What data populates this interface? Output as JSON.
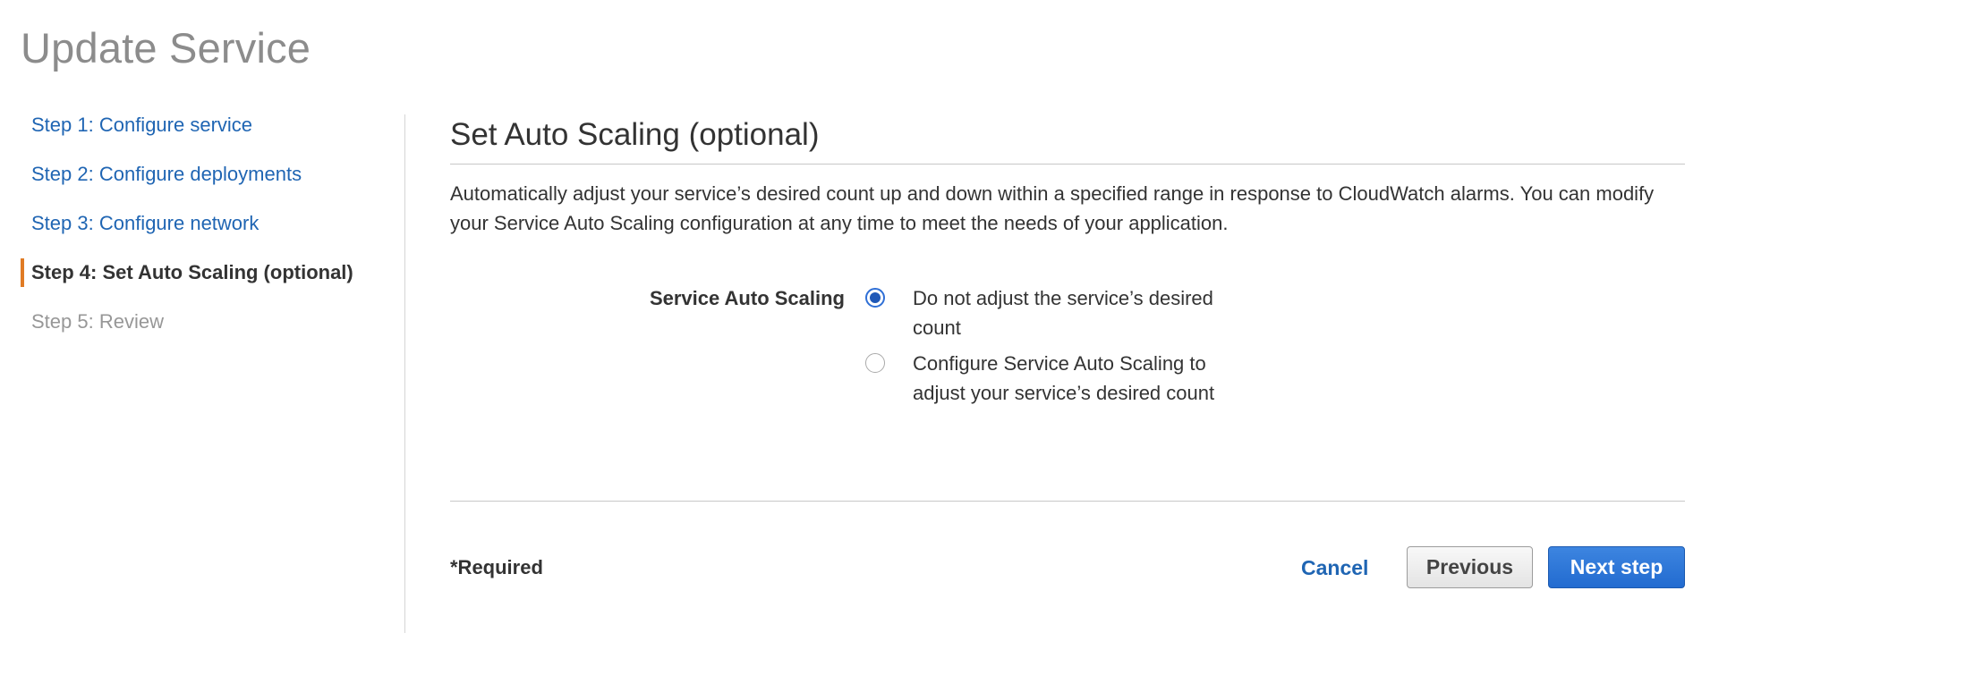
{
  "page": {
    "title": "Update Service"
  },
  "sidebar": {
    "steps": [
      {
        "label": "Step 1: Configure service",
        "state": "link"
      },
      {
        "label": "Step 2: Configure deployments",
        "state": "link"
      },
      {
        "label": "Step 3: Configure network",
        "state": "link"
      },
      {
        "label": "Step 4: Set Auto Scaling (optional)",
        "state": "active"
      },
      {
        "label": "Step 5: Review",
        "state": "disabled"
      }
    ]
  },
  "main": {
    "section_title": "Set Auto Scaling (optional)",
    "description": "Automatically adjust your service’s desired count up and down within a specified range in response to CloudWatch alarms. You can modify your Service Auto Scaling configuration at any time to meet the needs of your application.",
    "field": {
      "label": "Service Auto Scaling",
      "options": [
        {
          "label": "Do not adjust the service’s desired count",
          "selected": true
        },
        {
          "label": "Configure Service Auto Scaling to adjust your service’s desired count",
          "selected": false
        }
      ]
    },
    "footer": {
      "required_note": "*Required",
      "cancel_label": "Cancel",
      "previous_label": "Previous",
      "next_label": "Next step"
    }
  },
  "colors": {
    "link": "#1f65b3",
    "active_marker": "#e07b24",
    "primary_button": "#226bd0",
    "radio_selected": "#1f58b7"
  }
}
